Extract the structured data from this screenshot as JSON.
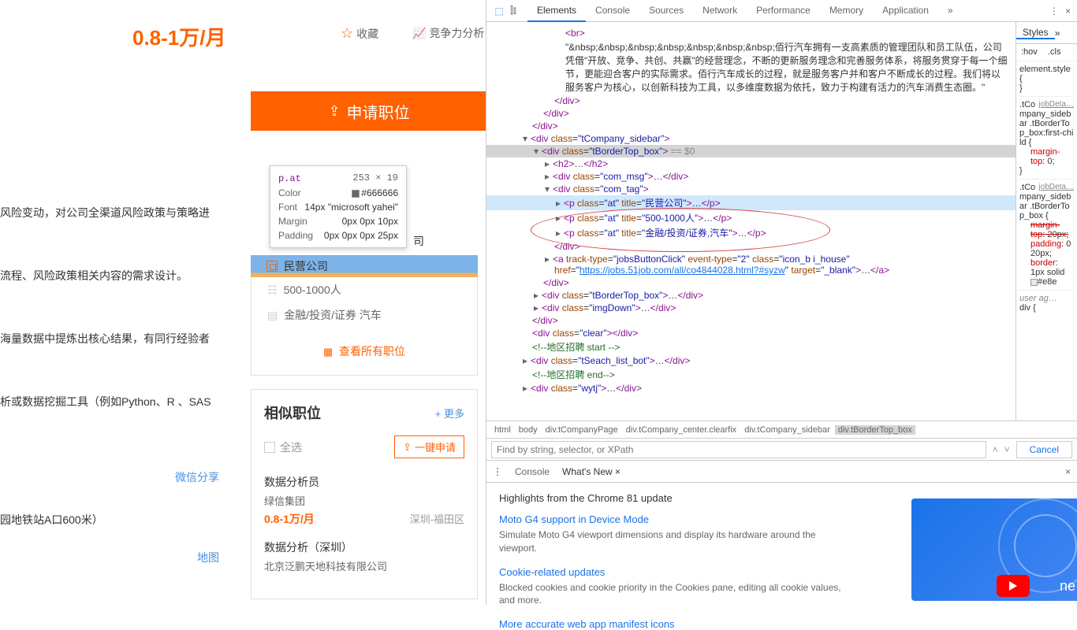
{
  "webpage": {
    "salary": "0.8-1万/月",
    "fav_label": "收藏",
    "compete_label": "竞争力分析",
    "apply_label": "申请职位",
    "texts": {
      "t1": "风险变动，对公司全渠道风险政策与策略进",
      "t2": "流程、风险政策相关内容的需求设计。",
      "t3": "海量数据中提炼出核心结果，有同行经验者",
      "t4": "析或数据挖掘工具（例如Python、R 、SAS",
      "t5": "园地铁站A口600米）"
    },
    "wechat_share": "微信分享",
    "map_link": "地图",
    "company_label": "司",
    "tooltip": {
      "selector": "p.at",
      "dim": "253 × 19",
      "color_label": "Color",
      "color_val": "#666666",
      "font_label": "Font",
      "font_val": "14px \"microsoft yahei\"",
      "margin_label": "Margin",
      "margin_val": "0px 0px 10px",
      "padding_label": "Padding",
      "padding_val": "0px 0px 0px 25px"
    },
    "company_info": {
      "type": "民营公司",
      "size": "500-1000人",
      "industry": "金融/投资/证券 汽车"
    },
    "view_all": "查看所有职位",
    "similar": {
      "title": "相似职位",
      "more": "+ 更多",
      "select_all": "全选",
      "quick_apply": "一键申请",
      "jobs": [
        {
          "title": "数据分析员",
          "company": "绿信集团",
          "salary": "0.8-1万/月",
          "loc": "深圳-福田区"
        },
        {
          "title": "数据分析（深圳）",
          "company": "北京泛鹏天地科技有限公司",
          "salary": "",
          "loc": ""
        }
      ]
    }
  },
  "devtools": {
    "tabs": [
      "Elements",
      "Console",
      "Sources",
      "Network",
      "Performance",
      "Memory",
      "Application"
    ],
    "active_tab": "Elements",
    "dom_text": "\"&nbsp;&nbsp;&nbsp;&nbsp;&nbsp;&nbsp;&nbsp;佰行汽车拥有一支高素质的管理团队和员工队伍，公司凭借\"开放、竞争、共创、共赢\"的经营理念，不断的更新服务理念和完善服务体系，将服务贯穿于每一个细节，更能迎合客户的实际需求。佰行汽车成长的过程，就是服务客户并和客户不断成长的过程。我们将以服务客户为核心，以创新科技为工具，以多维度数据为依托，致力于构建有活力的汽车消费生态圈。\"",
    "attrs": {
      "sidebar_class": "tCompany_sidebar",
      "border_class": "tBorderTop_box",
      "selected_marker": " == $0",
      "com_msg": "com_msg",
      "com_tag": "com_tag",
      "at": "at",
      "title1": "民营公司",
      "title2": "500-1000人",
      "title3": "金融/投资/证券,汽车",
      "track_type": "jobsButtonClick",
      "event_type": "2",
      "icon_class": "icon_b i_house",
      "href": "https://jobs.51job.com/all/co4844028.html?#syzw",
      "target": "_blank",
      "img_down": "imgDown",
      "clear": "clear",
      "comment1": "地区招聘 start",
      "tseach": "tSeach_list_bot",
      "comment2": "地区招聘 end",
      "wytj": "wytj"
    },
    "styles_tab": "Styles",
    "hov": ":hov",
    "cls": ".cls",
    "element_style": "element.style {",
    "rule1_link": "jobDeta…",
    "rule1_sel": ".tCompany_sidebar .tBorderTop_box:first-child {",
    "rule1_prop": "margin-top",
    "rule1_val": ": 0;",
    "rule2_link": "jobDeta…",
    "rule2_sel": ".tCompany_sidebar .tBorderTop_box {",
    "rule2_prop1": "margin-top",
    "rule2_val1": ": 20px;",
    "rule2_prop2": "padding",
    "rule2_val2": ": 0 20px;",
    "rule2_prop3": "border",
    "rule2_val3": ": 1px solid",
    "rule2_color": "#e8e",
    "user_agent": "user ag…",
    "div_sel": "div {",
    "breadcrumb": [
      "html",
      "body",
      "div.tCompanyPage",
      "div.tCompany_center.clearfix",
      "div.tCompany_sidebar",
      "div.tBorderTop_box"
    ],
    "find_placeholder": "Find by string, selector, or XPath",
    "cancel": "Cancel",
    "drawer_tabs": [
      "Console",
      "What's New"
    ],
    "drawer_active": "What's New",
    "highlights": "Highlights from the Chrome 81 update",
    "news": [
      {
        "title": "Moto G4 support in Device Mode",
        "desc": "Simulate Moto G4 viewport dimensions and display its hardware around the viewport."
      },
      {
        "title": "Cookie-related updates",
        "desc": "Blocked cookies and cookie priority in the Cookies pane, editing all cookie values, and more."
      },
      {
        "title": "More accurate web app manifest icons",
        "desc": ""
      }
    ],
    "promo_txt": "ne"
  }
}
